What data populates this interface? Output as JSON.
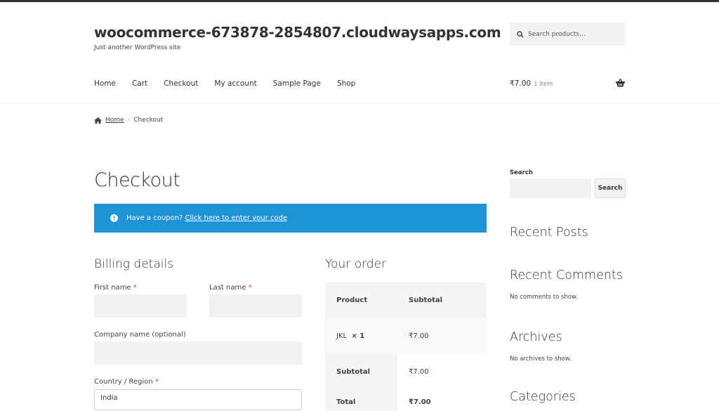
{
  "header": {
    "site_title": "woocommerce-673878-2854807.cloudwaysapps.com",
    "tagline": "Just another WordPress site",
    "search_placeholder": "Search products…"
  },
  "nav": [
    "Home",
    "Cart",
    "Checkout",
    "My account",
    "Sample Page",
    "Shop"
  ],
  "cart": {
    "total": "₹7.00",
    "count": "1 item"
  },
  "breadcrumb": {
    "home": "Home",
    "current": "Checkout"
  },
  "page_title": "Checkout",
  "notice": {
    "text": "Have a coupon?",
    "link": "Click here to enter your code"
  },
  "billing": {
    "title": "Billing details",
    "first_name": "First name",
    "last_name": "Last name",
    "company": "Company name (optional)",
    "country": "Country / Region",
    "country_value": "India",
    "required": "*"
  },
  "order": {
    "title": "Your order",
    "col_product": "Product",
    "col_subtotal": "Subtotal",
    "item": "JKL",
    "qty": "× 1",
    "item_price": "₹7.00",
    "subtotal_label": "Subtotal",
    "subtotal": "₹7.00",
    "total_label": "Total",
    "total": "₹7.00"
  },
  "sidebar": {
    "search_label": "Search",
    "search_button": "Search",
    "recent_posts": "Recent Posts",
    "recent_comments": "Recent Comments",
    "no_comments": "No comments to show.",
    "archives": "Archives",
    "no_archives": "No archives to show.",
    "categories": "Categories"
  },
  "colors": {
    "notice": "#1e94d6",
    "required": "#e2401c"
  }
}
